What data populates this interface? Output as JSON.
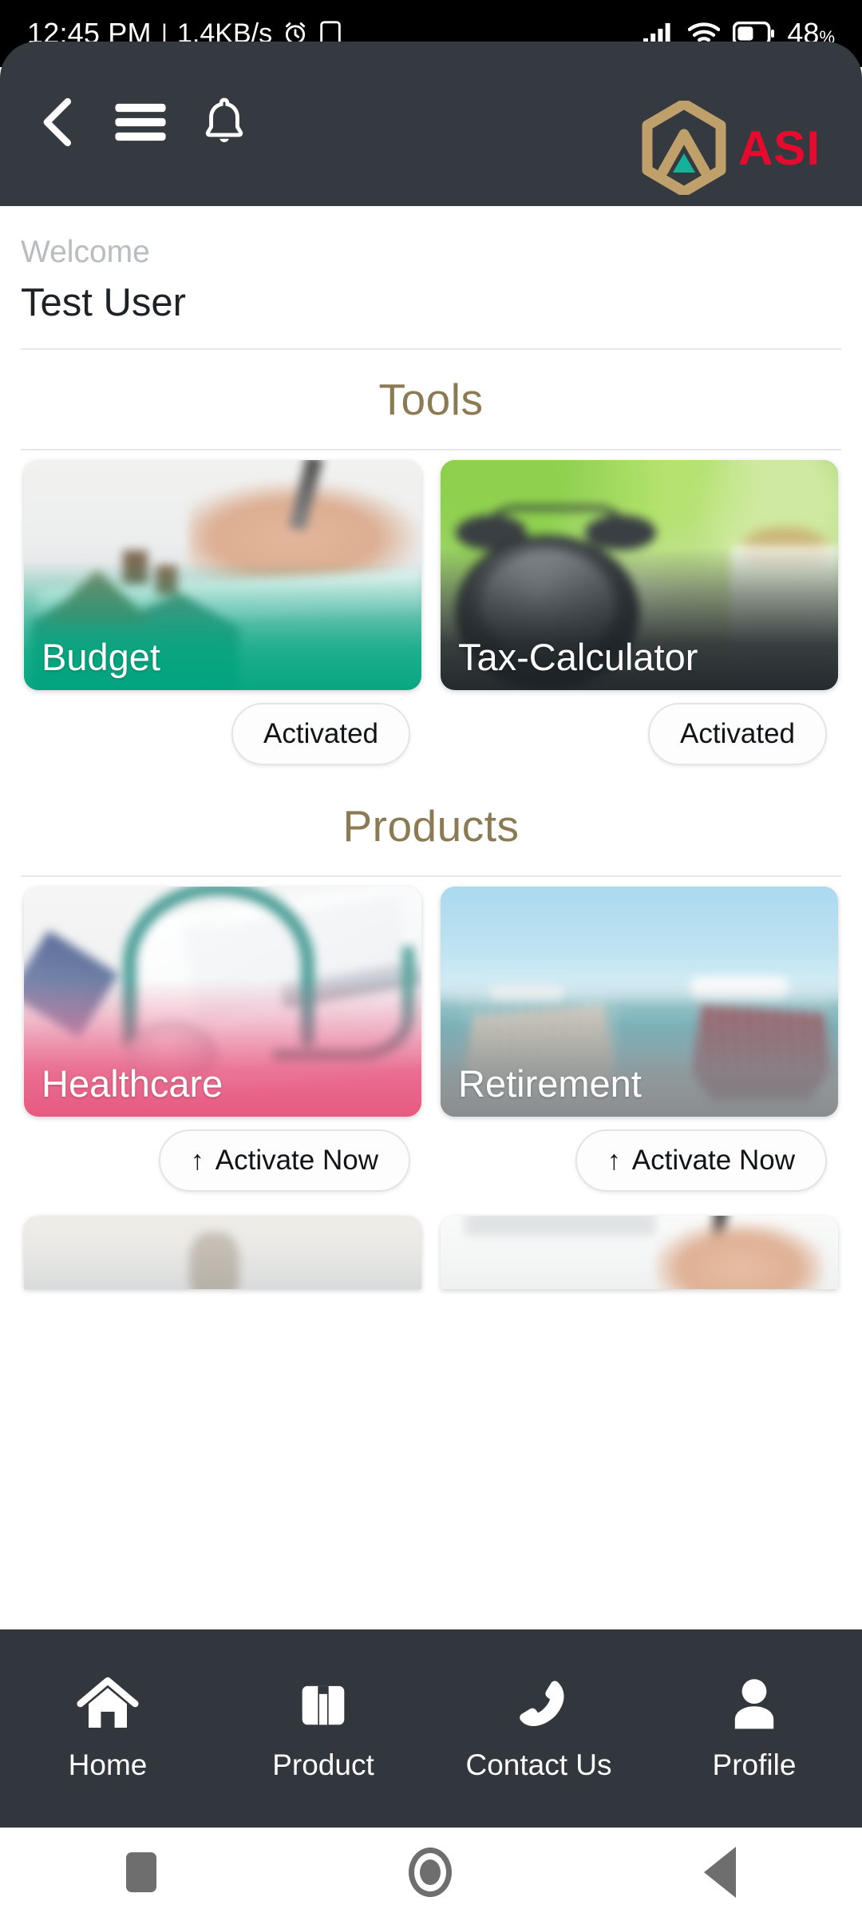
{
  "statusbar": {
    "time": "12:45 PM",
    "separator": "|",
    "data_rate": "1.4KB/s",
    "alarm_icon": "alarm-icon",
    "cast_icon": "cast-icon",
    "signal_icon": "signal-icon",
    "wifi_icon": "wifi-icon",
    "battery_icon": "battery-icon",
    "battery_percent": "48",
    "percent_symbol": "%"
  },
  "appbar": {
    "back_icon": "back-chevron-icon",
    "menu_icon": "hamburger-menu-icon",
    "notification_icon": "bell-icon",
    "brand_name": "ASI",
    "brand_color": "#e8092e",
    "logo_color": "#c0a06a",
    "logo_accent_color": "#13b39a",
    "background_color": "#353a41"
  },
  "welcome": {
    "label": "Welcome",
    "user_name": "Test User"
  },
  "sections": [
    {
      "title": "Tools",
      "title_color": "#8b7a52",
      "cards": [
        {
          "label": "Budget",
          "action": "Activated",
          "has_arrow": false
        },
        {
          "label": "Tax-Calculator",
          "action": "Activated",
          "has_arrow": false
        }
      ]
    },
    {
      "title": "Products",
      "title_color": "#8b7a52",
      "cards": [
        {
          "label": "Healthcare",
          "action": "Activate Now",
          "has_arrow": true,
          "arrow": "↑"
        },
        {
          "label": "Retirement",
          "action": "Activate Now",
          "has_arrow": true,
          "arrow": "↑"
        }
      ]
    }
  ],
  "bottom_nav": {
    "background_color": "#32373d",
    "items": [
      {
        "label": "Home",
        "icon": "home-icon"
      },
      {
        "label": "Product",
        "icon": "briefcase-icon"
      },
      {
        "label": "Contact Us",
        "icon": "phone-icon"
      },
      {
        "label": "Profile",
        "icon": "person-icon"
      }
    ]
  },
  "android_nav": {
    "recents_icon": "recents-square-icon",
    "home_icon": "home-circle-icon",
    "back_icon": "back-triangle-icon"
  }
}
